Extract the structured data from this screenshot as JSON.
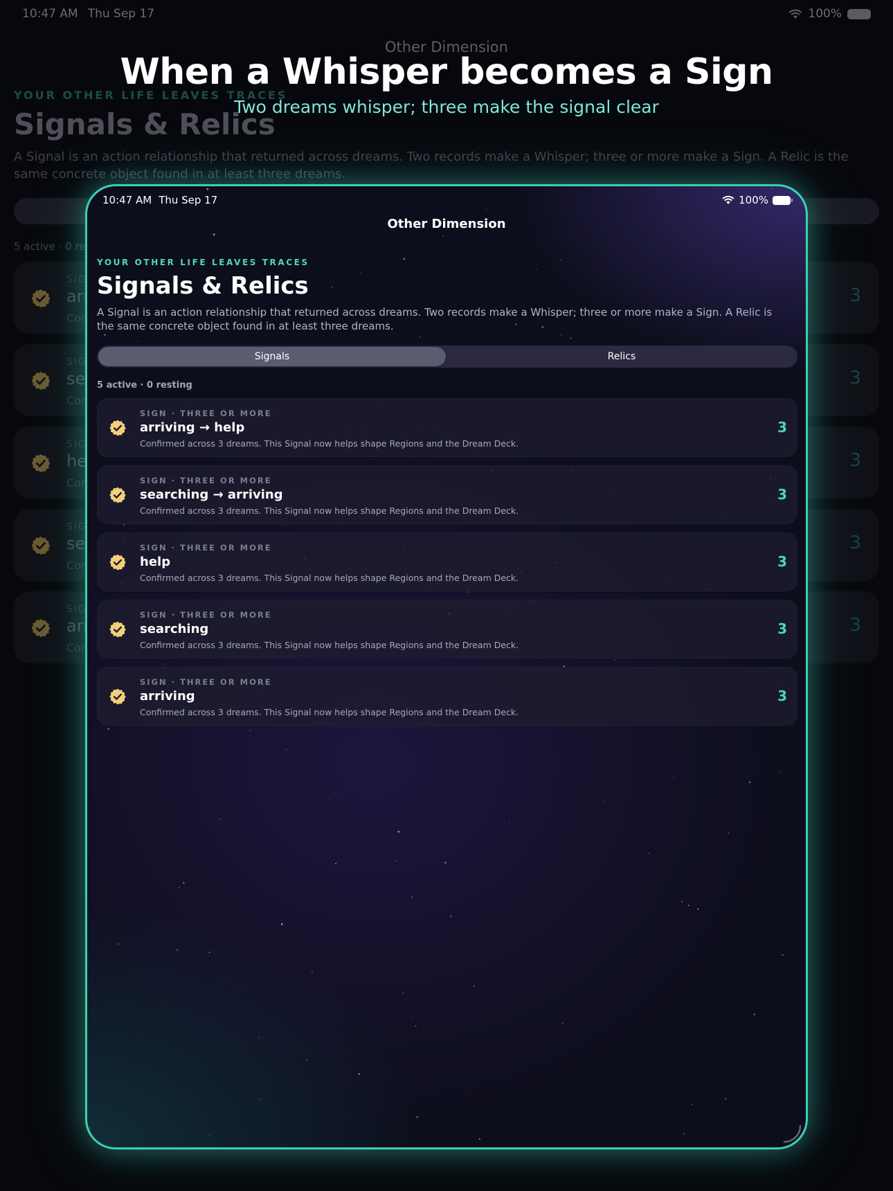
{
  "background": {
    "status": {
      "time": "10:47 AM",
      "date": "Thu Sep 17",
      "battery": "100%"
    },
    "nav_title": "Other Dimension",
    "eyebrow": "YOUR OTHER LIFE LEAVES TRACES",
    "heading": "Signals & Relics",
    "description": "A Signal is an action relationship that returned across dreams. Two records make a Whisper; three or more make a Sign. A Relic is the same concrete object found in at least three dreams.",
    "count": "5 active · 0 re",
    "rows": [
      {
        "tag": "SIG",
        "main": "arr",
        "sub": "Con",
        "count": "3"
      },
      {
        "tag": "SIG",
        "main": "sea",
        "sub": "Con",
        "count": "3"
      },
      {
        "tag": "SIG",
        "main": "he",
        "sub": "Con",
        "count": "3"
      },
      {
        "tag": "SIG",
        "main": "sea",
        "sub": "Con",
        "count": "3"
      },
      {
        "tag": "SIG",
        "main": "arr",
        "sub": "Con",
        "count": "3"
      }
    ]
  },
  "hero": {
    "title": "When a Whisper becomes a Sign",
    "subtitle": "Two dreams whisper; three make the signal clear"
  },
  "app": {
    "status": {
      "time": "10:47 AM",
      "date": "Thu Sep 17",
      "battery": "100%"
    },
    "nav_title": "Other Dimension",
    "eyebrow": "YOUR OTHER LIFE LEAVES TRACES",
    "heading": "Signals & Relics",
    "description": "A Signal is an action relationship that returned across dreams. Two records make a Whisper; three or more make a Sign. A Relic is the same concrete object found in at least three dreams.",
    "segments": {
      "signals": "Signals",
      "relics": "Relics",
      "selected": "Signals"
    },
    "count_text": "5 active · 0 resting",
    "signals": [
      {
        "tag": "SIGN · THREE OR MORE",
        "name": "arriving → help",
        "detail": "Confirmed across 3 dreams. This Signal now helps shape Regions and the Dream Deck.",
        "count": "3"
      },
      {
        "tag": "SIGN · THREE OR MORE",
        "name": "searching → arriving",
        "detail": "Confirmed across 3 dreams. This Signal now helps shape Regions and the Dream Deck.",
        "count": "3"
      },
      {
        "tag": "SIGN · THREE OR MORE",
        "name": "help",
        "detail": "Confirmed across 3 dreams. This Signal now helps shape Regions and the Dream Deck.",
        "count": "3"
      },
      {
        "tag": "SIGN · THREE OR MORE",
        "name": "searching",
        "detail": "Confirmed across 3 dreams. This Signal now helps shape Regions and the Dream Deck.",
        "count": "3"
      },
      {
        "tag": "SIGN · THREE OR MORE",
        "name": "arriving",
        "detail": "Confirmed across 3 dreams. This Signal now helps shape Regions and the Dream Deck.",
        "count": "3"
      }
    ]
  },
  "colors": {
    "accent": "#46d8c1",
    "badge": "#f3cf7a",
    "frame": "#3ecfb4"
  },
  "icons": {
    "badge": "seal-check-icon",
    "wifi": "wifi-icon",
    "battery": "battery-icon"
  }
}
